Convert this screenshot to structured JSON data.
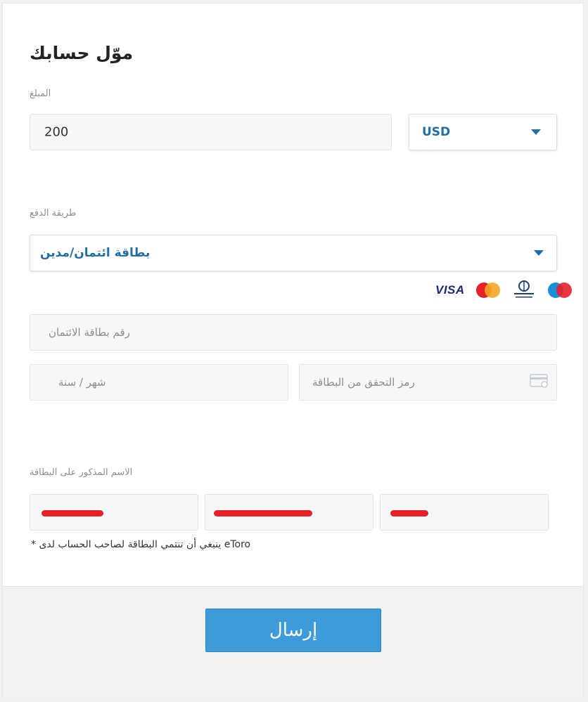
{
  "page": {
    "title": "موّل حسابك"
  },
  "amount": {
    "label": "المبلغ",
    "value": "200",
    "currency": "USD"
  },
  "payment": {
    "label": "طريقة الدفع",
    "method": "بطاقة ائتمان/مدين",
    "brands": [
      "VISA",
      "MasterCard",
      "Diners Club",
      "Maestro"
    ],
    "card_number_placeholder": "رقم بطاقة الائتمان",
    "expiry_placeholder": "شهر / سنة",
    "cvv_placeholder": "رمز التحقق من البطاقة"
  },
  "name_on_card": {
    "label": "الاسم المذكور على البطاقة",
    "note": "eToro ينبغي أن تنتمي البطاقة لصاحب الحساب لدى *"
  },
  "submit": {
    "label": "إرسال"
  },
  "colors": {
    "accent": "#1e70a8",
    "button": "#3e9ad8",
    "redaction": "#e8202a"
  },
  "icons": {
    "dropdown": "caret-down-icon",
    "cvv": "credit-card-icon"
  }
}
